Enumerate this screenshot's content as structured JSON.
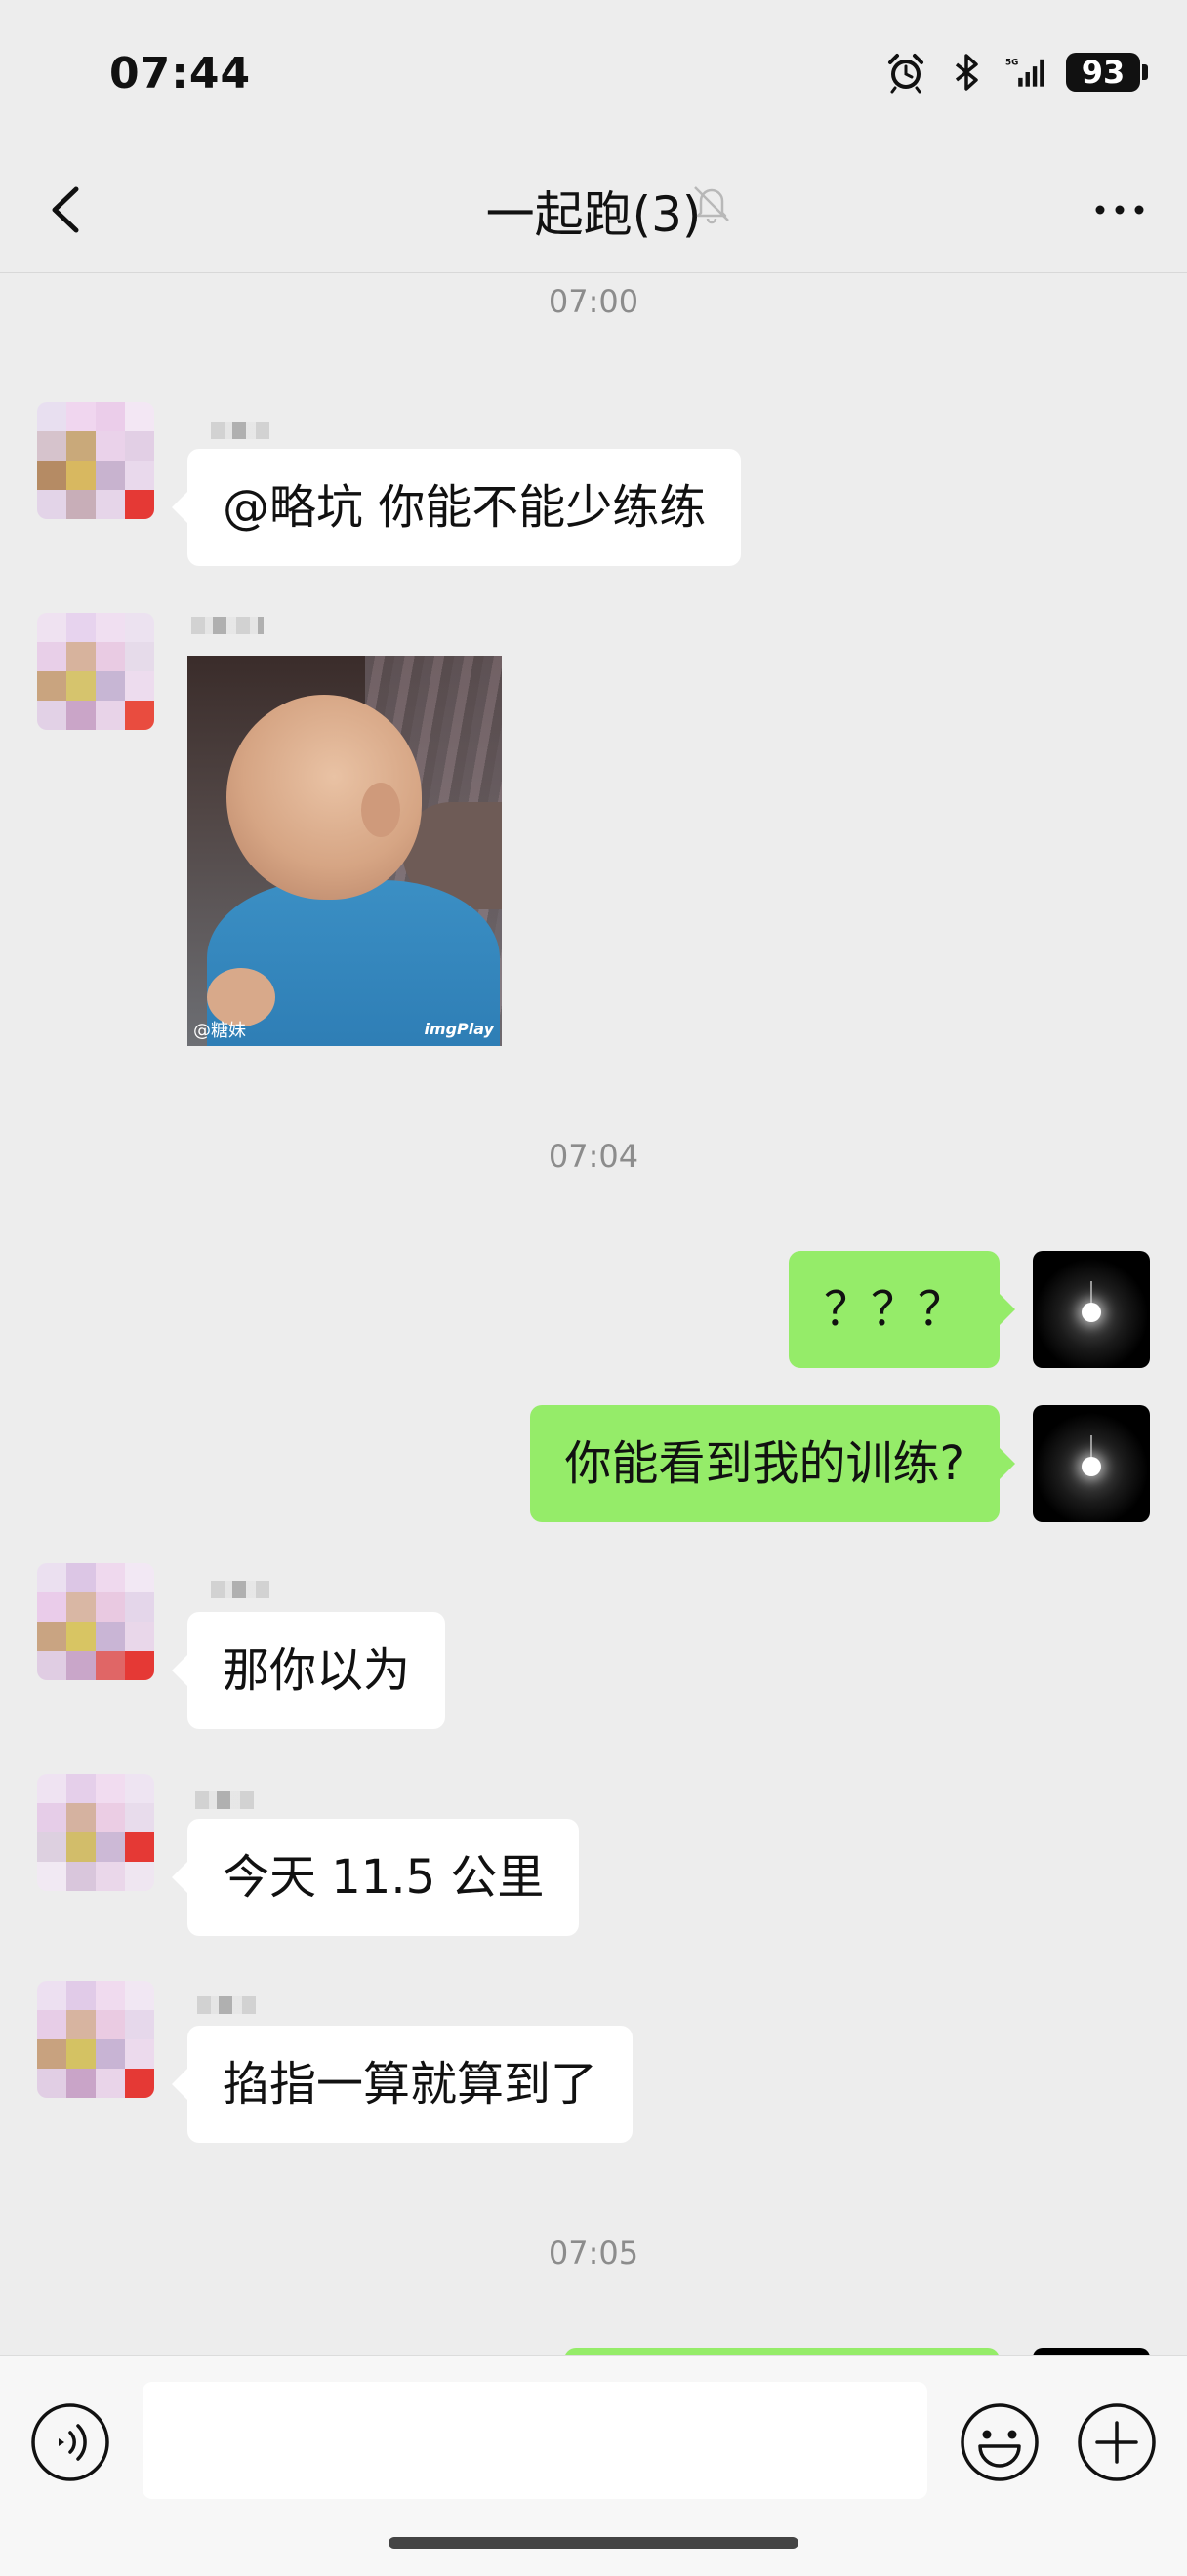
{
  "status_bar": {
    "time": "07:44",
    "network": "5G",
    "battery": "93",
    "icons": [
      "alarm-icon",
      "bluetooth-icon",
      "signal-icon",
      "battery-icon"
    ]
  },
  "nav": {
    "title": "一起跑(3)",
    "back_icon": "chevron-left-icon",
    "mute_icon": "bell-off-icon",
    "more_icon": "more-dots-icon"
  },
  "messages": {
    "ts1": "07:00",
    "m1": "@略坑  你能不能少练练",
    "image_watermark_left": "@糖妹",
    "image_watermark_right": "imgPlay",
    "ts2": "07:04",
    "m3": "？？？",
    "m4": "你能看到我的训练?",
    "m5": "那你以为",
    "m6": "今天 11.5 公里",
    "m7": "掐指一算就算到了",
    "ts3": "07:05"
  },
  "input": {
    "placeholder": "",
    "voice_icon": "voice-icon",
    "emoji_icon": "emoji-icon",
    "plus_icon": "plus-icon"
  },
  "colors": {
    "background": "#ededed",
    "outgoing_bubble": "#95ec69",
    "incoming_bubble": "#ffffff",
    "timestamp": "#8c8c8c"
  }
}
